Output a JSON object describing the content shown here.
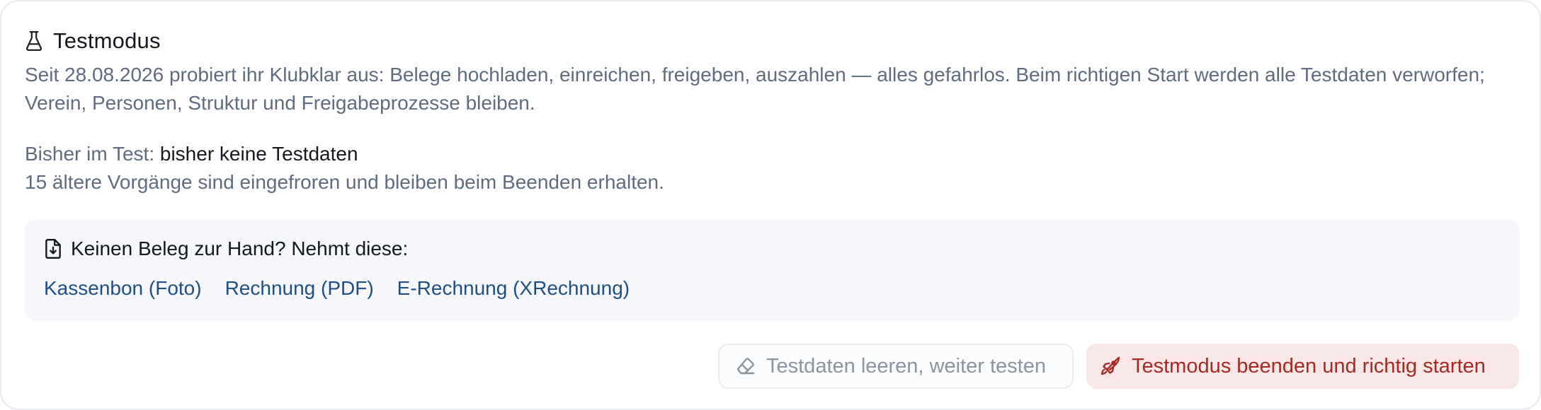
{
  "card": {
    "title": "Testmodus",
    "title_icon": "flask-icon",
    "description": "Seit 28.08.2026 probiert ihr Klubklar aus: Belege hochladen, einreichen, freigeben, auszahlen — alles gefahrlos. Beim richtigen Start werden alle Testdaten verworfen; Verein, Personen, Struktur und Freigabeprozesse bleiben.",
    "status_label": "Bisher im Test:",
    "status_value": "bisher keine Testdaten",
    "frozen_note": "15 ältere Vorgänge sind eingefroren und bleiben beim Beenden erhalten."
  },
  "samples": {
    "icon": "file-download-icon",
    "title": "Keinen Beleg zur Hand? Nehmt diese:",
    "links": [
      "Kassenbon (Foto)",
      "Rechnung (PDF)",
      "E-Rechnung (XRechnung)"
    ]
  },
  "actions": {
    "clear_label": "Testdaten leeren, weiter testen",
    "clear_icon": "eraser-icon",
    "start_label": "Testmodus beenden und richtig starten",
    "start_icon": "rocket-icon"
  },
  "colors": {
    "text_primary": "#14181f",
    "text_muted": "#5f6b7e",
    "link": "#1e4f82",
    "danger": "#a52a23",
    "danger_bg": "#f8e7e6",
    "panel_bg": "#f5f7fa"
  }
}
